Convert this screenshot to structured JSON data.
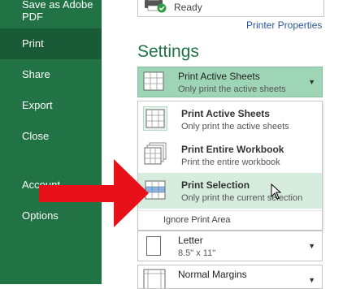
{
  "nav": {
    "items": [
      {
        "label_line1": "Save as Adobe",
        "label_line2": "PDF"
      },
      {
        "label": "Print"
      },
      {
        "label": "Share"
      },
      {
        "label": "Export"
      },
      {
        "label": "Close"
      },
      {
        "label": "Account"
      },
      {
        "label": "Options"
      }
    ],
    "active": "Print",
    "color": "#217346",
    "active_color": "#195a37"
  },
  "printer": {
    "status": "Ready",
    "properties_link": "Printer Properties",
    "icon": "printer-icon"
  },
  "settings": {
    "title": "Settings",
    "accent": "#217346",
    "print_what": {
      "selected_title": "Print Active Sheets",
      "selected_subtitle": "Only print the active sheets",
      "options": [
        {
          "title": "Print Active Sheets",
          "subtitle": "Only print the active sheets",
          "icon": "active-sheets-icon"
        },
        {
          "title": "Print Entire Workbook",
          "subtitle": "Print the entire workbook",
          "icon": "workbook-icon"
        },
        {
          "title": "Print Selection",
          "subtitle": "Only print the current selection",
          "icon": "selection-icon",
          "hovered": true
        }
      ],
      "ignore_print_area": "Ignore Print Area"
    },
    "paper": {
      "title": "Letter",
      "subtitle": "8.5\" x 11\""
    },
    "margins": {
      "title": "Normal Margins"
    }
  },
  "annotation": {
    "arrow_color": "#e8111a"
  }
}
